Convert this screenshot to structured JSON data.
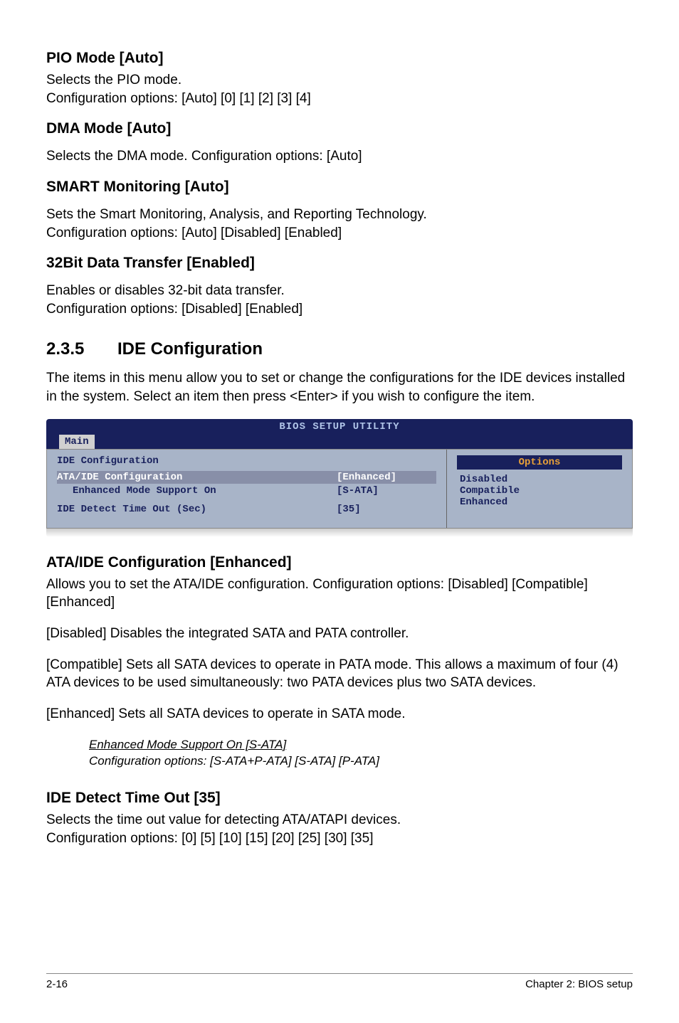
{
  "s1": {
    "title": "PIO Mode [Auto]",
    "line1": "Selects the PIO mode.",
    "line2": "Configuration options: [Auto] [0] [1] [2] [3] [4]"
  },
  "s2": {
    "title": "DMA Mode [Auto]",
    "line1": "Selects the DMA mode. Configuration options: [Auto]"
  },
  "s3": {
    "title": "SMART Monitoring [Auto]",
    "line1": "Sets the Smart Monitoring, Analysis, and Reporting Technology.",
    "line2": "Configuration options: [Auto] [Disabled] [Enabled]"
  },
  "s4": {
    "title": "32Bit Data Transfer [Enabled]",
    "line1": "Enables or disables 32-bit data transfer.",
    "line2": "Configuration options: [Disabled] [Enabled]"
  },
  "main": {
    "num": "2.3.5",
    "title": "IDE Configuration",
    "intro": "The items in this menu allow you to set or change the configurations for the IDE devices installed in the system. Select an item then press <Enter> if you wish to configure the item."
  },
  "bios": {
    "title": "BIOS SETUP UTILITY",
    "tab": "Main",
    "panel_title": "IDE Configuration",
    "row1_label": "ATA/IDE Configuration",
    "row1_value": "[Enhanced]",
    "row2_label": "Enhanced Mode Support On",
    "row2_value": "[S-ATA]",
    "row3_label": "IDE Detect Time Out (Sec)",
    "row3_value": "[35]",
    "options_header": "Options",
    "opt1": "Disabled",
    "opt2": "Compatible",
    "opt3": "Enhanced"
  },
  "ata": {
    "title": "ATA/IDE Configuration [Enhanced]",
    "p1": "Allows you to set the ATA/IDE configuration. Configuration options: [Disabled] [Compatible] [Enhanced]",
    "p2": "[Disabled] Disables the integrated SATA and PATA controller.",
    "p3": "[Compatible] Sets all SATA devices to operate in PATA mode. This allows a maximum of four (4) ATA devices to be used simultaneously: two PATA devices plus two SATA devices.",
    "p4": "[Enhanced] Sets all SATA devices to operate in SATA mode."
  },
  "italic": {
    "line1": "Enhanced Mode Support On [S-ATA]",
    "line2": "Configuration options: [S-ATA+P-ATA] [S-ATA] [P-ATA]"
  },
  "ide_detect": {
    "title": "IDE Detect Time Out [35]",
    "line1": "Selects the time out value for detecting ATA/ATAPI devices.",
    "line2": "Configuration options: [0] [5] [10] [15] [20] [25] [30] [35]"
  },
  "footer": {
    "left": "2-16",
    "right": "Chapter 2: BIOS setup"
  }
}
